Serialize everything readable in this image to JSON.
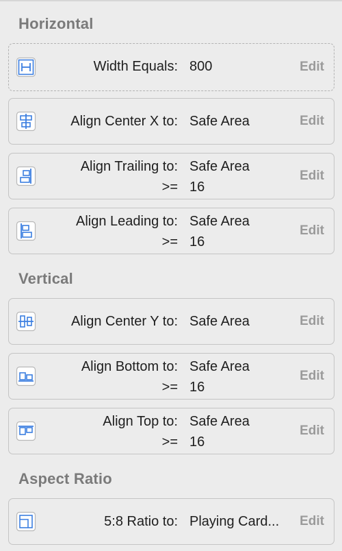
{
  "sections": {
    "horizontal": "Horizontal",
    "vertical": "Vertical",
    "aspect_ratio": "Aspect Ratio"
  },
  "constraints": {
    "width": {
      "label": "Width Equals:",
      "value": "800",
      "edit": "Edit",
      "icon": "width-icon"
    },
    "center_x": {
      "label": "Align Center X to:",
      "value": "Safe Area",
      "edit": "Edit",
      "icon": "align-center-x-icon"
    },
    "trailing": {
      "label": "Align Trailing to:",
      "value": "Safe Area",
      "relation": ">=",
      "constant": "16",
      "edit": "Edit",
      "icon": "align-trailing-icon"
    },
    "leading": {
      "label": "Align Leading to:",
      "value": "Safe Area",
      "relation": ">=",
      "constant": "16",
      "edit": "Edit",
      "icon": "align-leading-icon"
    },
    "center_y": {
      "label": "Align Center Y to:",
      "value": "Safe Area",
      "edit": "Edit",
      "icon": "align-center-y-icon"
    },
    "bottom": {
      "label": "Align Bottom to:",
      "value": "Safe Area",
      "relation": ">=",
      "constant": "16",
      "edit": "Edit",
      "icon": "align-bottom-icon"
    },
    "top": {
      "label": "Align Top to:",
      "value": "Safe Area",
      "relation": ">=",
      "constant": "16",
      "edit": "Edit",
      "icon": "align-top-icon"
    },
    "ratio": {
      "label": "5:8 Ratio to:",
      "value": "Playing Card...",
      "edit": "Edit",
      "icon": "aspect-ratio-icon"
    }
  },
  "colors": {
    "icon_blue": "#3b7ee0",
    "section_title": "#7a7a7a",
    "edit": "#9a9a9a",
    "row_border": "#c4c4c4"
  }
}
